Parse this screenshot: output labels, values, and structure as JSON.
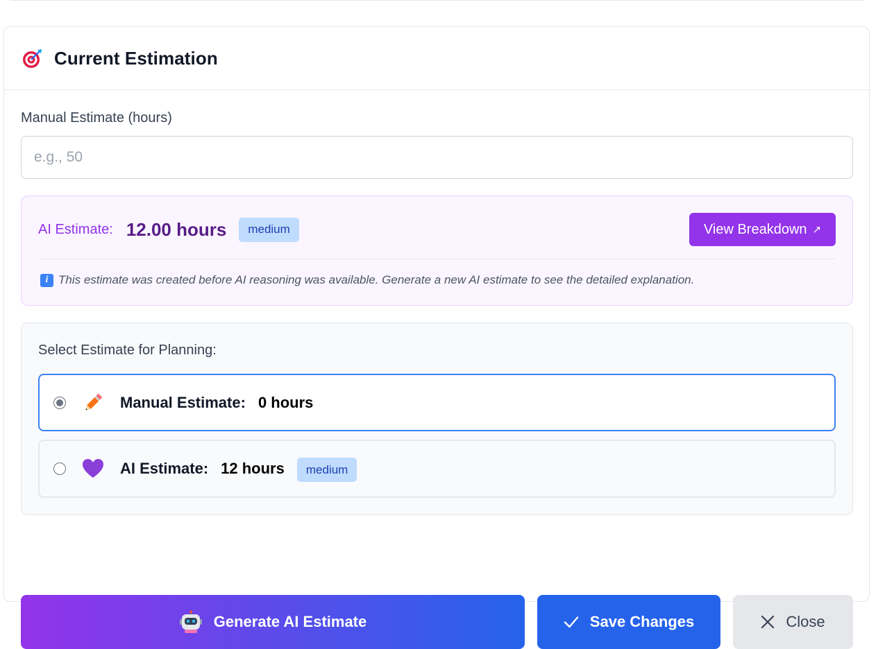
{
  "header": {
    "icon": "target-icon",
    "title": "Current Estimation"
  },
  "manual_field": {
    "label": "Manual Estimate (hours)",
    "value": "",
    "placeholder": "e.g., 50"
  },
  "ai_panel": {
    "label": "AI Estimate:",
    "value": "12.00 hours",
    "confidence": "medium",
    "view_button": "View Breakdown",
    "view_icon": "external-link-icon",
    "note_icon": "info-icon",
    "note": "This estimate was created before AI reasoning was available. Generate a new AI estimate to see the detailed explanation."
  },
  "selection": {
    "title": "Select Estimate for Planning:",
    "selected": "manual",
    "options": [
      {
        "id": "manual",
        "icon": "pencil-icon",
        "label": "Manual Estimate:",
        "value": "0 hours"
      },
      {
        "id": "ai",
        "icon": "purple-heart-icon",
        "label": "AI Estimate:",
        "value": "12 hours",
        "badge": "medium"
      }
    ]
  },
  "actions": {
    "generate": {
      "label": "Generate AI Estimate",
      "icon": "robot-icon"
    },
    "save": {
      "label": "Save Changes",
      "icon": "check-icon"
    },
    "close": {
      "label": "Close",
      "icon": "close-icon"
    }
  },
  "colors": {
    "accent_purple": "#9333ea",
    "accent_blue": "#2563eb",
    "selected_border": "#3b82f6",
    "badge_bg": "#bfdbfe"
  }
}
